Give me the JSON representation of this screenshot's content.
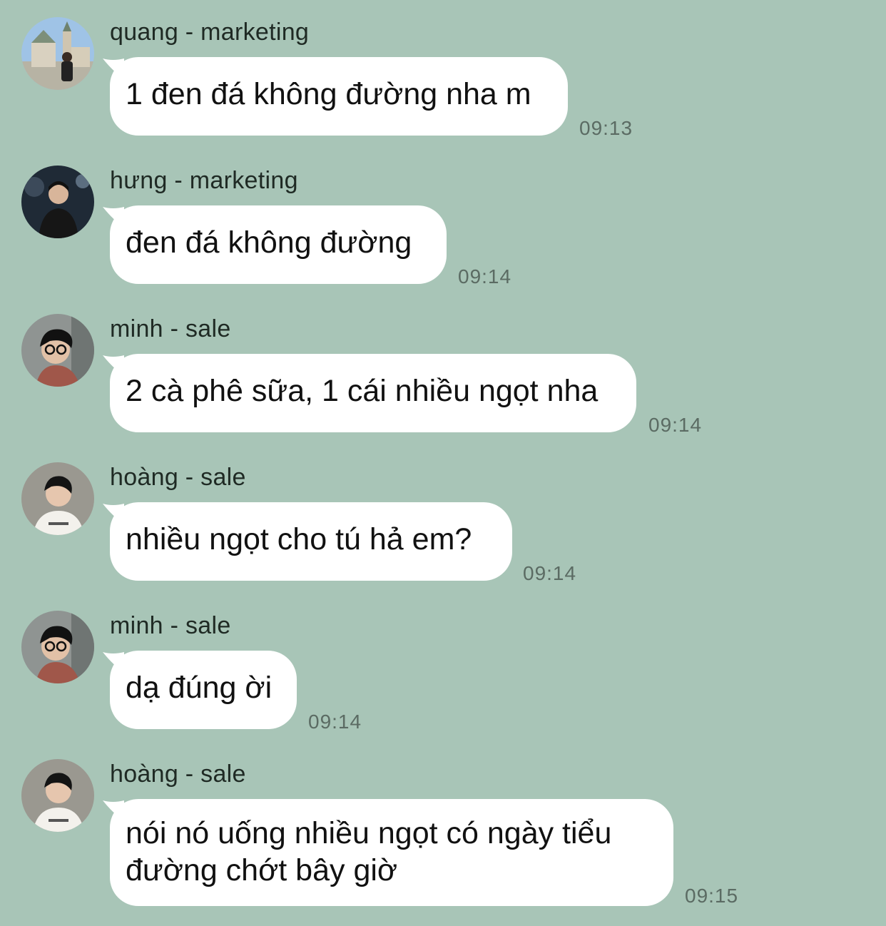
{
  "messages": [
    {
      "sender": "quang - marketing",
      "text": "1 đen đá không đường nha m",
      "time": "09:13",
      "avatar": "avatar-photo-building"
    },
    {
      "sender": "hưng - marketing",
      "text": "đen đá không đường",
      "time": "09:14",
      "avatar": "avatar-photo-dark"
    },
    {
      "sender": "minh - sale",
      "text": "2 cà phê sữa, 1 cái nhiều ngọt nha",
      "time": "09:14",
      "avatar": "avatar-photo-glasses"
    },
    {
      "sender": "hoàng - sale",
      "text": "nhiều ngọt cho tú hả em?",
      "time": "09:14",
      "avatar": "avatar-photo-white-shirt"
    },
    {
      "sender": "minh - sale",
      "text": "dạ đúng ời",
      "time": "09:14",
      "avatar": "avatar-photo-glasses"
    },
    {
      "sender": "hoàng - sale",
      "text": "nói nó uống nhiều ngọt có ngày tiểu đường chớt bây giờ",
      "time": "09:15",
      "avatar": "avatar-photo-white-shirt"
    }
  ],
  "colors": {
    "background": "#a8c5b7",
    "bubble": "#ffffff",
    "time": "#5b6b63"
  }
}
